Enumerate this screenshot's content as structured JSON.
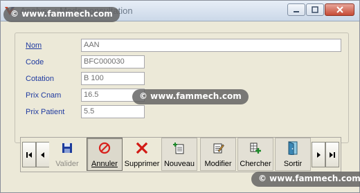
{
  "window": {
    "title": "Analyse : Mode consultation"
  },
  "watermark": "© www.fammech.com",
  "form": {
    "fields": [
      {
        "label": "Nom",
        "value": "AAN"
      },
      {
        "label": "Code",
        "value": "BFC000030"
      },
      {
        "label": "Cotation",
        "value": "B 100"
      },
      {
        "label": "Prix Cnam",
        "value": "16.5"
      },
      {
        "label": "Prix Patient",
        "value": "5.5"
      }
    ]
  },
  "toolbar": {
    "buttons": [
      {
        "label": "Valider",
        "icon": "floppy-disk-icon",
        "state": "disabled"
      },
      {
        "label": "Annuler",
        "icon": "no-entry-icon",
        "state": "pressed"
      },
      {
        "label": "Supprimer",
        "icon": "red-x-icon",
        "state": "normal"
      },
      {
        "label": "Nouveau",
        "icon": "new-document-icon",
        "state": "normal"
      },
      {
        "label": "Modifier",
        "icon": "edit-document-icon",
        "state": "normal"
      },
      {
        "label": "Chercher",
        "icon": "search-grid-icon",
        "state": "normal"
      },
      {
        "label": "Sortir",
        "icon": "exit-door-icon",
        "state": "normal"
      }
    ]
  },
  "colors": {
    "label_blue": "#1f3aa0",
    "close_red": "#c64b36"
  }
}
